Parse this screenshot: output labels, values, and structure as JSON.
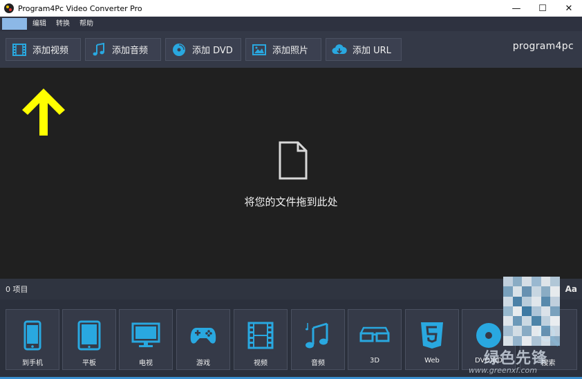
{
  "window": {
    "title": "Program4Pc Video Converter Pro",
    "controls": {
      "minimize": "—",
      "maximize": "☐",
      "close": "✕"
    }
  },
  "menu": {
    "items": [
      {
        "label": "",
        "active": true
      },
      {
        "label": "编辑",
        "active": false
      },
      {
        "label": "转换",
        "active": false
      },
      {
        "label": "帮助",
        "active": false
      }
    ]
  },
  "toolbar": {
    "buttons": [
      {
        "label": "添加视频",
        "icon": "film-icon"
      },
      {
        "label": "添加音频",
        "icon": "music-note-icon"
      },
      {
        "label": "添加 DVD",
        "icon": "disc-icon"
      },
      {
        "label": "添加照片",
        "icon": "image-icon"
      },
      {
        "label": "添加 URL",
        "icon": "cloud-download-icon"
      }
    ],
    "logo": "program4pc"
  },
  "drop": {
    "text": "将您的文件拖到此处"
  },
  "status": {
    "count_text": "0 项目",
    "font_toggle": "Aa"
  },
  "profiles": [
    {
      "label": "到手机",
      "icon": "phone-icon"
    },
    {
      "label": "平板",
      "icon": "tablet-icon"
    },
    {
      "label": "电视",
      "icon": "tv-icon"
    },
    {
      "label": "游戏",
      "icon": "gamepad-icon"
    },
    {
      "label": "视频",
      "icon": "film-icon"
    },
    {
      "label": "音频",
      "icon": "music-notes-icon"
    },
    {
      "label": "3D",
      "icon": "3d-glasses-icon"
    },
    {
      "label": "Web",
      "icon": "html5-icon"
    },
    {
      "label": "DVD/BD",
      "icon": "disc-icon"
    },
    {
      "label": "搜索",
      "icon": "search-icon"
    }
  ],
  "watermark": {
    "text": "绿色先锋",
    "url": "www.greenxf.com"
  },
  "colors": {
    "accent": "#29a8e0",
    "arrow": "#ffff00",
    "toolbar_bg": "#343947",
    "drop_bg": "#202020"
  }
}
